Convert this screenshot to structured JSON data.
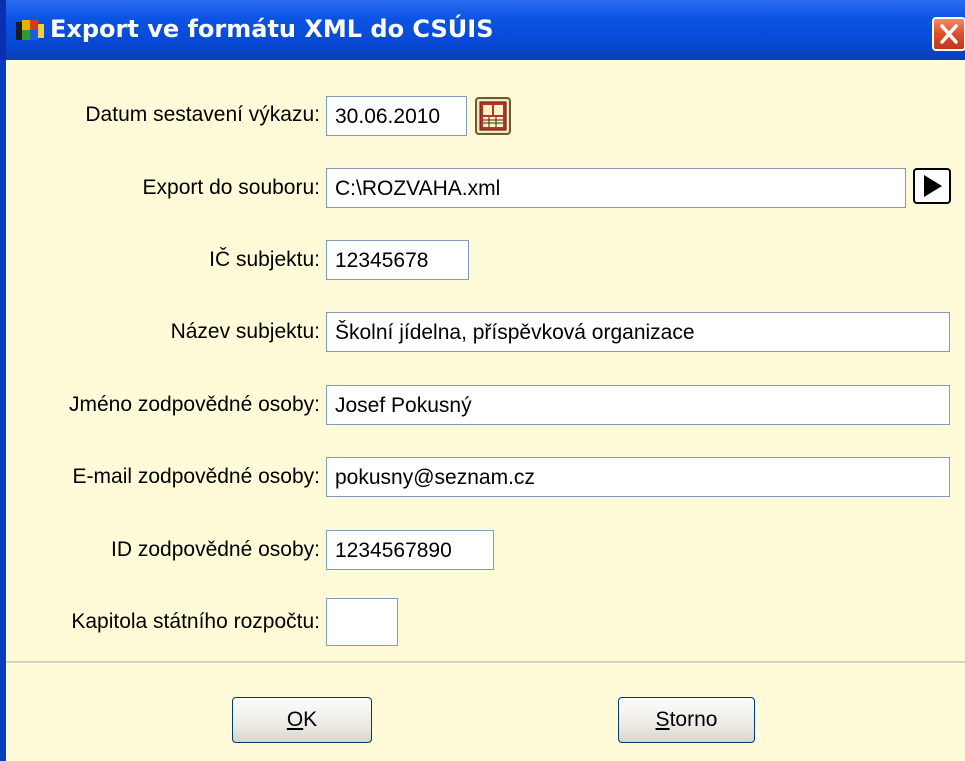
{
  "window": {
    "title": "Export ve formátu XML do CSÚIS",
    "close_glyph": "✕"
  },
  "form": {
    "datum_label": "Datum sestavení výkazu:",
    "datum_value": "30.06.2010",
    "export_label": "Export do souboru:",
    "export_value": "C:\\ROZVAHA.xml",
    "ic_label": "IČ subjektu:",
    "ic_value": "12345678",
    "nazev_label": "Název subjektu:",
    "nazev_value": "Školní jídelna, příspěvková organizace",
    "jmeno_label": "Jméno zodpovědné osoby:",
    "jmeno_value": "Josef Pokusný",
    "email_label": "E-mail zodpovědné osoby:",
    "email_value": "pokusny@seznam.cz",
    "id_label": "ID zodpovědné osoby:",
    "id_value": "1234567890",
    "kapitola_label": "Kapitola státního rozpočtu:",
    "kapitola_value": ""
  },
  "buttons": {
    "ok_mnemonic": "O",
    "ok_rest": "K",
    "storno_mnemonic": "S",
    "storno_rest": "torno"
  },
  "icons": {
    "app": "app-flag-icon",
    "calendar": "calendar-icon",
    "browse": "play-arrow-icon",
    "close": "close-icon"
  },
  "colors": {
    "title_bar": "#0c54e4",
    "dialog_bg": "#fffbd9",
    "close_button": "#e04d2b"
  }
}
